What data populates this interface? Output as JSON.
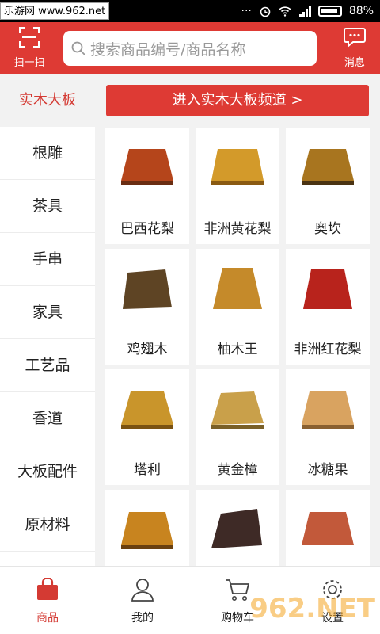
{
  "statusbar": {
    "badge": "乐游网 www.962.net",
    "battery": "88%"
  },
  "header": {
    "scan_label": "扫一扫",
    "search_placeholder": "搜索商品编号/商品名称",
    "message_label": "消息",
    "accent_color": "#de3a34"
  },
  "category": {
    "title": "实木大板",
    "channel_button": "进入实木大板频道 >"
  },
  "sidebar": {
    "items": [
      "根雕",
      "茶具",
      "手串",
      "家具",
      "工艺品",
      "香道",
      "大板配件",
      "原材料"
    ]
  },
  "products": [
    {
      "name": "巴西花梨",
      "color": "#b5451b"
    },
    {
      "name": "非洲黄花梨",
      "color": "#d39a2a"
    },
    {
      "name": "奥坎",
      "color": "#a8751f"
    },
    {
      "name": "鸡翅木",
      "color": "#5e4424"
    },
    {
      "name": "柚木王",
      "color": "#c58a2a"
    },
    {
      "name": "非洲红花梨",
      "color": "#b8231c"
    },
    {
      "name": "塔利",
      "color": "#c9952b"
    },
    {
      "name": "黄金樟",
      "color": "#c9a04a"
    },
    {
      "name": "冰糖果",
      "color": "#d9a360"
    },
    {
      "name": "",
      "color": "#c8841f"
    },
    {
      "name": "",
      "color": "#3e2a26"
    },
    {
      "name": "",
      "color": "#c2593a"
    }
  ],
  "tabbar": {
    "tabs": [
      {
        "label": "商品",
        "icon": "bag-icon"
      },
      {
        "label": "我的",
        "icon": "person-icon"
      },
      {
        "label": "购物车",
        "icon": "cart-icon"
      },
      {
        "label": "设置",
        "icon": "gear-icon"
      }
    ]
  },
  "watermark": "962.NET"
}
